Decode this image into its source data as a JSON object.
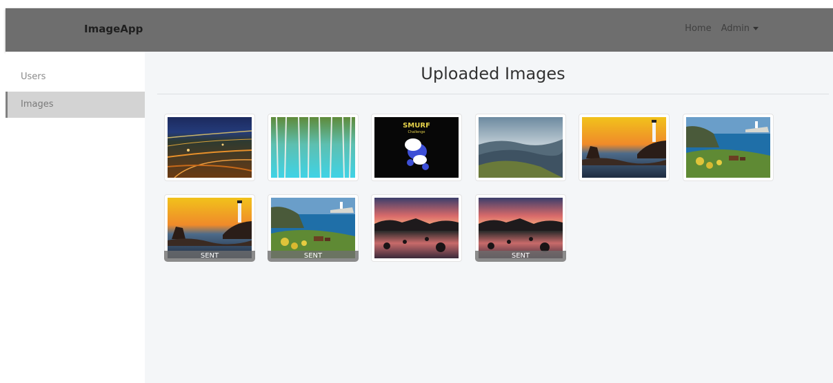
{
  "navbar": {
    "brand": "ImageApp",
    "home": "Home",
    "admin": "Admin"
  },
  "sidebar": {
    "items": [
      {
        "label": "Users",
        "active": false
      },
      {
        "label": "Images",
        "active": true
      }
    ]
  },
  "main": {
    "title": "Uploaded Images",
    "images": [
      {
        "scene": "city-night",
        "status": ""
      },
      {
        "scene": "blue-pond",
        "status": ""
      },
      {
        "scene": "smurf",
        "status": ""
      },
      {
        "scene": "mountains",
        "status": ""
      },
      {
        "scene": "lighthouse-sunset",
        "status": ""
      },
      {
        "scene": "coast-cows",
        "status": ""
      },
      {
        "scene": "lighthouse-sunset",
        "status": "SENT"
      },
      {
        "scene": "coast-cows",
        "status": "SENT"
      },
      {
        "scene": "pink-sunset",
        "status": ""
      },
      {
        "scene": "pink-sunset",
        "status": "SENT"
      }
    ],
    "smurf_text": {
      "line1": "SMURF",
      "line2": "Challenge"
    }
  }
}
